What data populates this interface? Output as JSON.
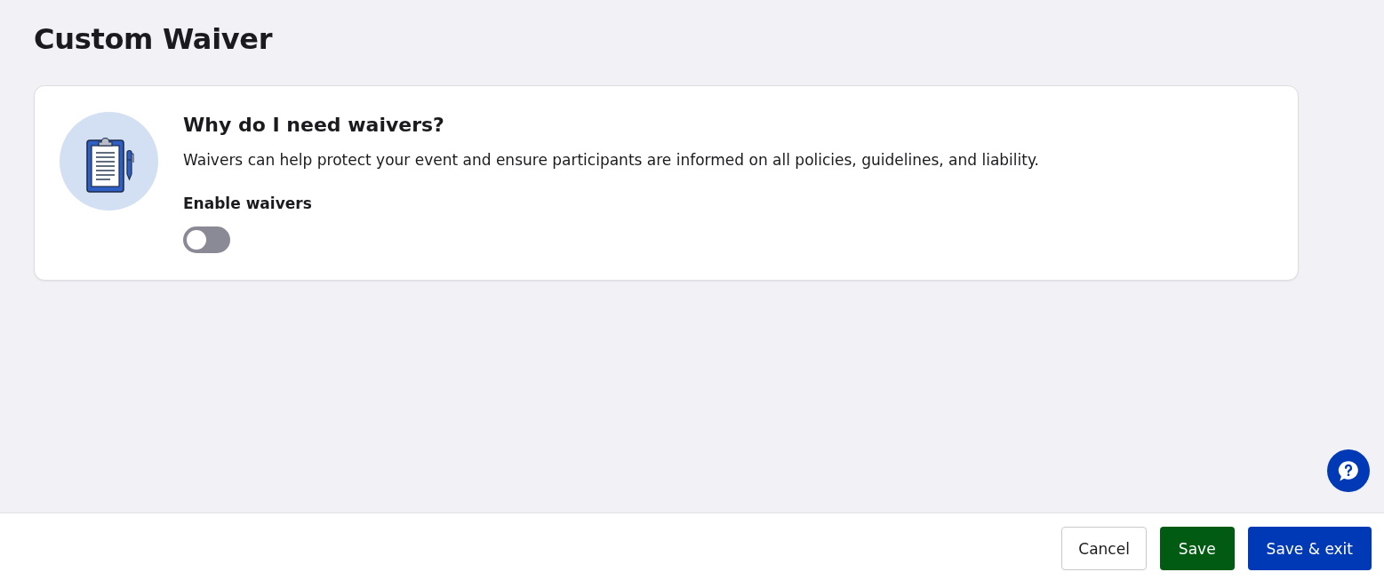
{
  "page": {
    "title": "Custom Waiver"
  },
  "info_card": {
    "heading": "Why do I need waivers?",
    "description": "Waivers can help protect your event and ensure participants are informed on all policies, guidelines, and liability.",
    "setting": {
      "label": "Enable waivers",
      "on": false
    }
  },
  "footer": {
    "buttons": [
      {
        "label": "Cancel",
        "kind": "secondary"
      },
      {
        "label": "Save",
        "kind": "success"
      },
      {
        "label": "Save & exit",
        "kind": "primary"
      }
    ]
  }
}
